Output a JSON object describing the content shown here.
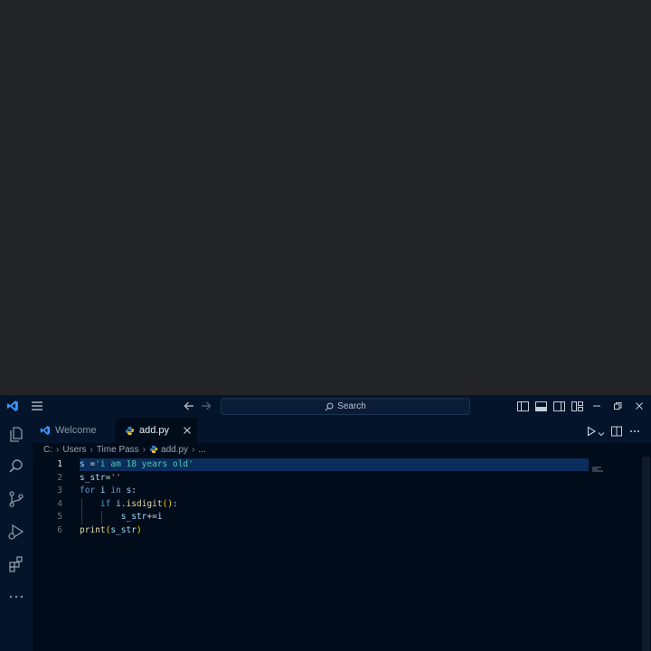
{
  "title_bar": {
    "search_placeholder": "Search",
    "icons": [
      "vscode-logo",
      "menu-icon",
      "back-arrow-icon",
      "forward-arrow-icon",
      "toggle-primary-sidebar-icon",
      "toggle-panel-icon",
      "toggle-secondary-sidebar-icon",
      "customize-layout-icon",
      "minimize-icon",
      "restore-icon",
      "close-icon"
    ]
  },
  "activity_bar": {
    "items": [
      "explorer-icon",
      "search-icon",
      "source-control-icon",
      "run-debug-icon",
      "extensions-icon",
      "more-icon"
    ]
  },
  "tabs": [
    {
      "label": "Welcome",
      "icon": "vscode-logo",
      "active": false
    },
    {
      "label": "add.py",
      "icon": "python-icon",
      "active": true
    }
  ],
  "breadcrumb": [
    "C:",
    "Users",
    "Time Pass",
    "add.py",
    "..."
  ],
  "editor": {
    "current_line": 1,
    "lines": [
      {
        "n": "1",
        "tokens": [
          [
            "s",
            "t-var"
          ],
          [
            " =",
            "t-op"
          ],
          [
            "'i am 18 years old'",
            "t-str2"
          ]
        ]
      },
      {
        "n": "2",
        "tokens": [
          [
            "s_str",
            "t-var"
          ],
          [
            "=",
            "t-op"
          ],
          [
            "''",
            "t-str"
          ]
        ]
      },
      {
        "n": "3",
        "tokens": [
          [
            "for",
            "t-kw"
          ],
          [
            " ",
            "t-op"
          ],
          [
            "i",
            "t-var"
          ],
          [
            " ",
            "t-op"
          ],
          [
            "in",
            "t-kw"
          ],
          [
            " ",
            "t-op"
          ],
          [
            "s",
            "t-var"
          ],
          [
            ":",
            "t-op"
          ]
        ]
      },
      {
        "n": "4",
        "tokens": [
          [
            "    ",
            "t-op"
          ],
          [
            "if",
            "t-kw"
          ],
          [
            " ",
            "t-op"
          ],
          [
            "i",
            "t-var"
          ],
          [
            ".",
            "t-op"
          ],
          [
            "isdigit",
            "t-fn"
          ],
          [
            "()",
            "t-p1"
          ],
          [
            ":",
            "t-op"
          ]
        ]
      },
      {
        "n": "5",
        "tokens": [
          [
            "        ",
            "t-op"
          ],
          [
            "s_str",
            "t-var"
          ],
          [
            "+=",
            "t-op"
          ],
          [
            "i",
            "t-var"
          ]
        ]
      },
      {
        "n": "6",
        "tokens": [
          [
            "print",
            "t-fn"
          ],
          [
            "(",
            "t-p1"
          ],
          [
            "s_str",
            "t-var"
          ],
          [
            ")",
            "t-p1"
          ]
        ]
      }
    ]
  },
  "colors": {
    "accent": "#3794ff",
    "background": "#010c1a",
    "titlebar": "#03142b"
  }
}
